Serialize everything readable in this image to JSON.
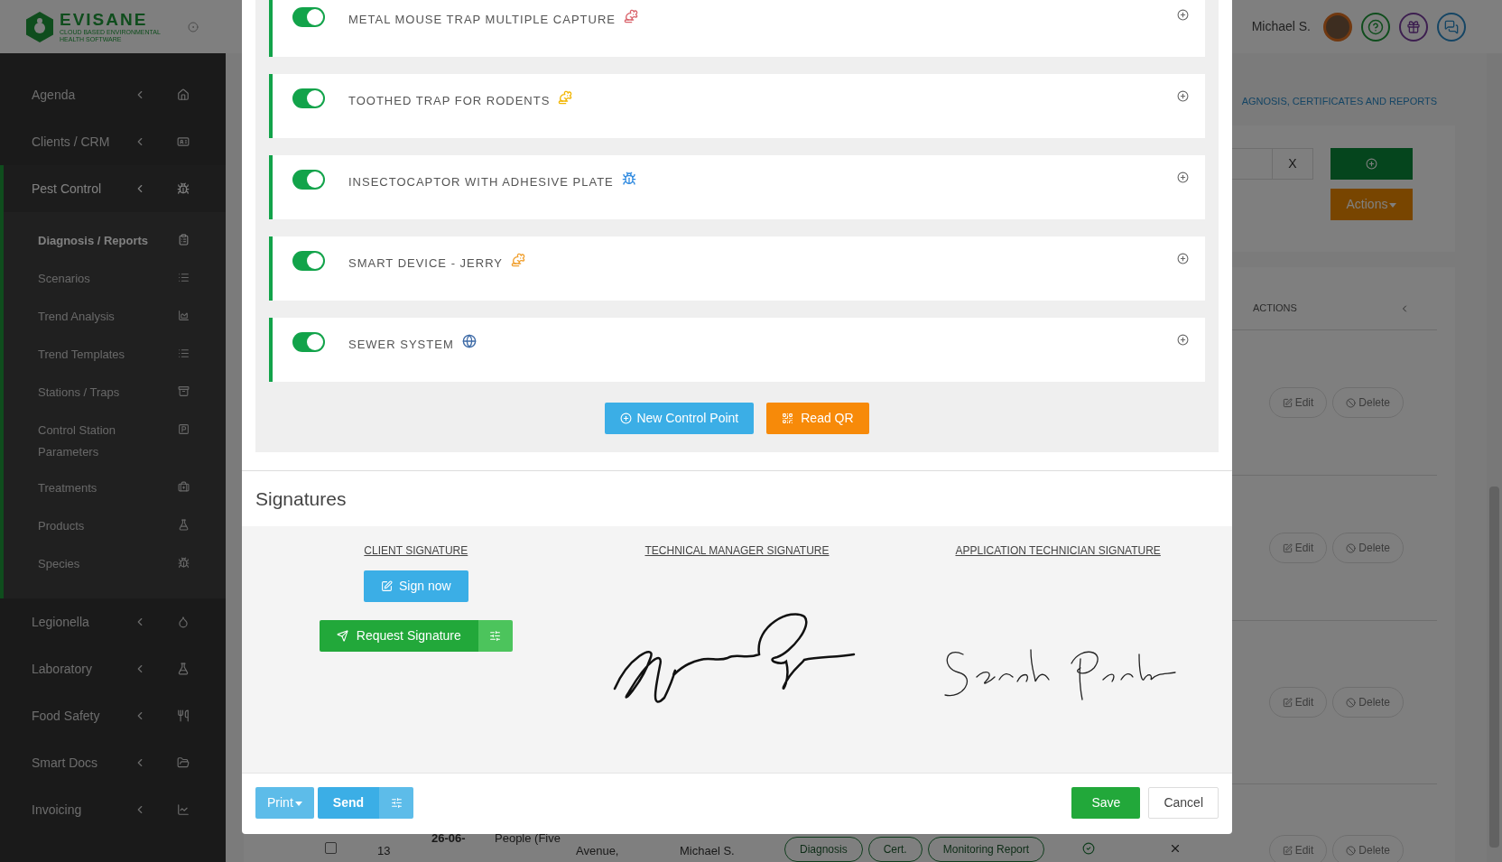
{
  "app": {
    "brand": "EVISANE",
    "tagline": "CLOUD BASED ENVIRONMENTAL HEALTH SOFTWARE"
  },
  "sidebar": {
    "items": [
      {
        "label": "Agenda",
        "expanded": false
      },
      {
        "label": "Clients / CRM",
        "expanded": false
      },
      {
        "label": "Pest Control",
        "expanded": true,
        "children": [
          {
            "label": "Diagnosis / Reports",
            "selected": true
          },
          {
            "label": "Scenarios",
            "selected": false
          },
          {
            "label": "Trend Analysis",
            "selected": false
          },
          {
            "label": "Trend Templates",
            "selected": false
          },
          {
            "label": "Stations / Traps",
            "selected": false
          },
          {
            "label": "Control Station Parameters",
            "selected": false
          },
          {
            "label": "Treatments",
            "selected": false
          },
          {
            "label": "Products",
            "selected": false
          },
          {
            "label": "Species",
            "selected": false
          }
        ]
      },
      {
        "label": "Legionella",
        "expanded": false
      },
      {
        "label": "Laboratory",
        "expanded": false
      },
      {
        "label": "Food Safety",
        "expanded": false
      },
      {
        "label": "Smart Docs",
        "expanded": false
      },
      {
        "label": "Invoicing",
        "expanded": false
      }
    ]
  },
  "header": {
    "user": "Michael S."
  },
  "breadcrumb": "AGNOSIS, CERTIFICATES AND REPORTS",
  "filter": {
    "clear_button": "X",
    "actions_button": "Actions"
  },
  "table": {
    "columns": [
      {
        "label": "ACTIONS"
      }
    ],
    "rows": [
      {
        "edit": "Edit",
        "delete": "Delete"
      },
      {
        "edit": "Edit",
        "delete": "Delete"
      },
      {
        "edit": "Edit",
        "delete": "Delete"
      },
      {
        "checked": false,
        "cells": [
          "13",
          "26-06-",
          "People (Five",
          "Avenue,",
          "Michael S."
        ],
        "tags": [
          "Diagnosis",
          "Cert.",
          "Monitoring Report"
        ],
        "edit": "Edit",
        "delete": "Delete"
      }
    ]
  },
  "modal": {
    "control_points": [
      {
        "name": "METAL MOUSE TRAP MULTIPLE CAPTURE",
        "on": true,
        "color": "#d9646c"
      },
      {
        "name": "TOOTHED TRAP FOR RODENTS",
        "on": true,
        "color": "#f2b705"
      },
      {
        "name": "INSECTOCAPTOR WITH ADHESIVE PLATE",
        "on": true,
        "color": "#2f8ae0"
      },
      {
        "name": "SMART DEVICE - JERRY",
        "on": true,
        "color": "#f0a030"
      },
      {
        "name": "SEWER SYSTEM",
        "on": true,
        "color": "#3d6aa6"
      }
    ],
    "new_point_button": "New Control Point",
    "read_qr_button": "Read QR",
    "signatures": {
      "title": "Signatures",
      "columns": [
        {
          "kind": "buttons",
          "label": "CLIENT SIGNATURE",
          "sign_button": "Sign now",
          "request_button": "Request Signature"
        },
        {
          "kind": "signature",
          "label": "TECHNICAL MANAGER SIGNATURE"
        },
        {
          "kind": "signature",
          "label": "APPLICATION TECHNICIAN SIGNATURE"
        }
      ]
    },
    "footer": {
      "print": "Print",
      "send": "Send",
      "save": "Save",
      "cancel": "Cancel"
    }
  }
}
